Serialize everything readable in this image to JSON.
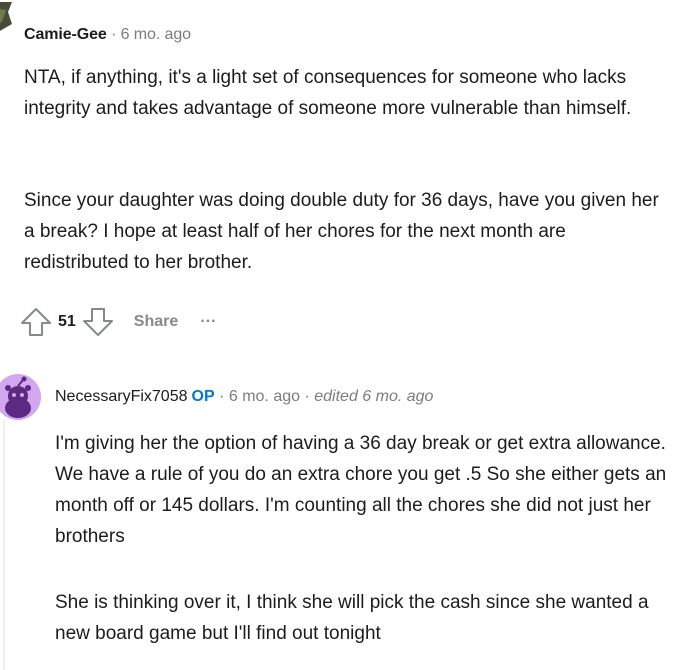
{
  "comment": {
    "author": "Camie-Gee",
    "time": "6 mo. ago",
    "paragraphs": [
      "NTA, if anything, it's a light set of consequences for someone who lacks integrity and takes advantage of someone more vulnerable than himself.",
      "Since your daughter was doing double duty for 36 days, have you given her a break? I hope at least half of her chores for the next month are redistributed to her brother."
    ],
    "score": "51",
    "share_label": "Share",
    "more_label": "..."
  },
  "reply": {
    "author": "NecessaryFix7058",
    "op_badge": "OP",
    "time": "6 mo. ago",
    "edited": "edited 6 mo. ago",
    "paragraphs": [
      "I'm giving her the option of having a 36 day break or get extra allowance. We have a rule of you do an extra chore you get .5 So she either gets an month off or 145 dollars. I'm counting all the chores she did not just her brothers",
      "She is thinking over it, I think she will pick the cash since she wanted a new board game but I'll find out tonight"
    ]
  },
  "separator": "·",
  "colors": {
    "accent": "#0079d3",
    "meta": "#7c7c7c",
    "avatar_bg": "#d3a7ef",
    "snoo": "#5c2a82"
  },
  "icons": [
    "user-avatar-icon",
    "upvote-icon",
    "downvote-icon",
    "snoo-avatar-icon"
  ]
}
